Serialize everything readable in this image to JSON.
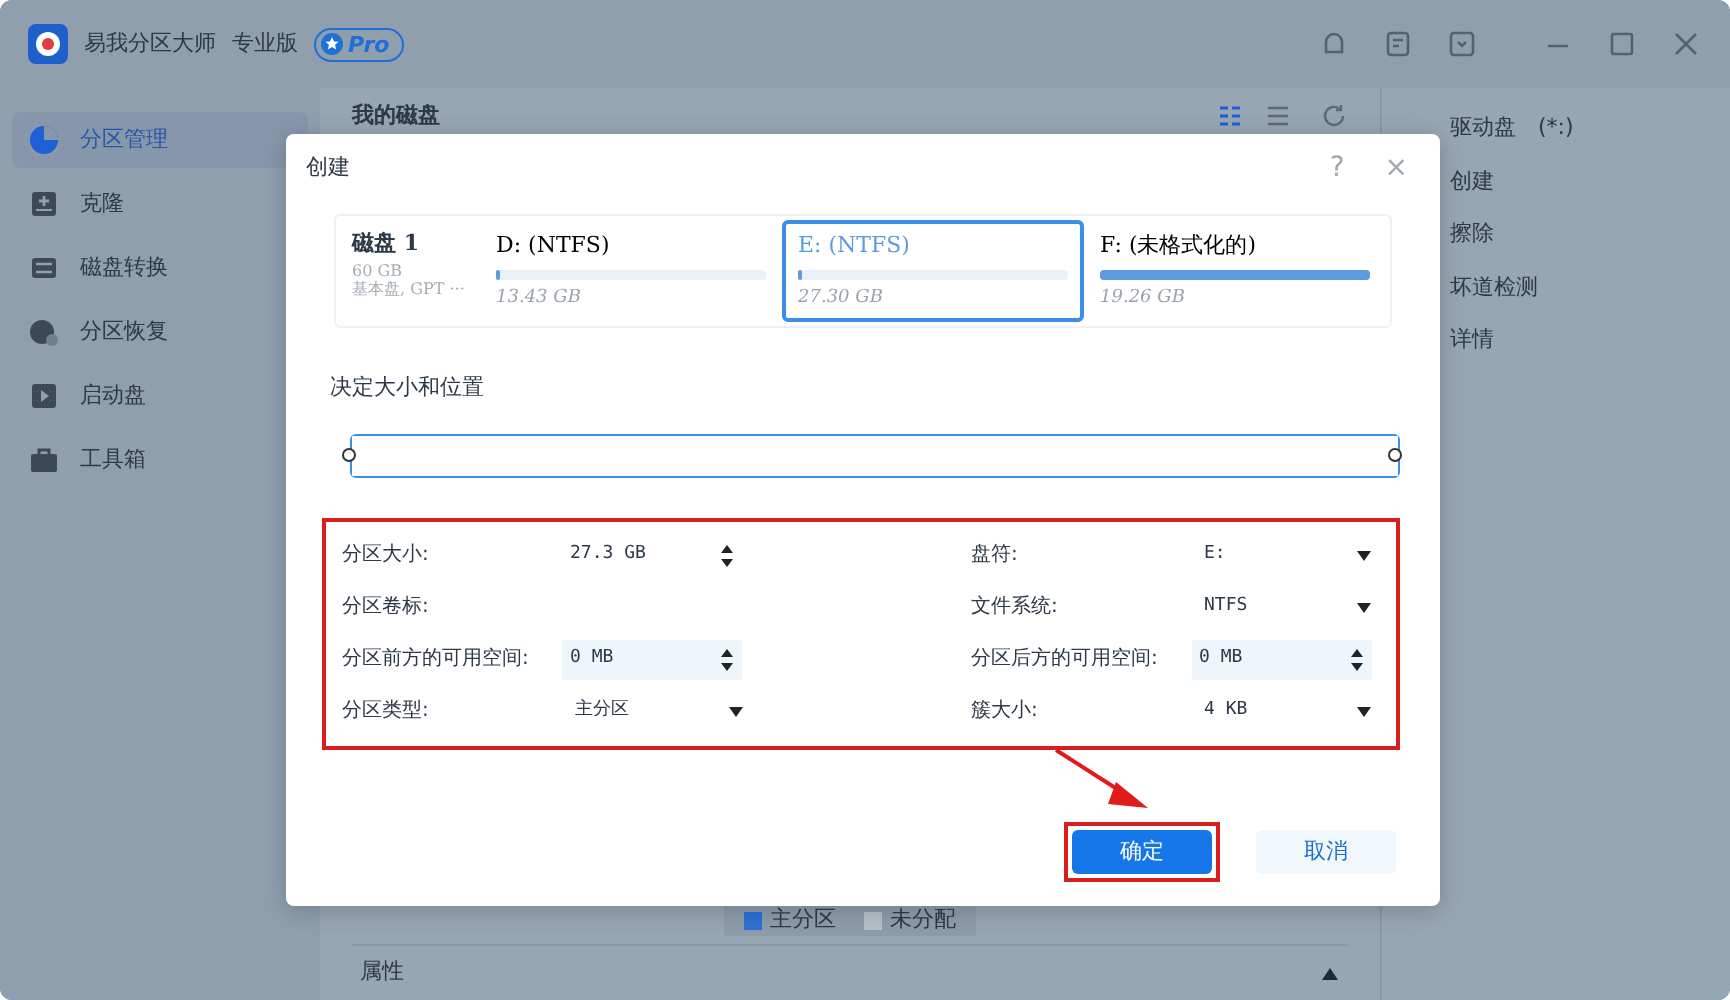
{
  "app": {
    "title": "易我分区大师",
    "edition": "专业版",
    "badge": "Pro"
  },
  "sidebar": {
    "items": [
      {
        "label": "分区管理",
        "selected": true
      },
      {
        "label": "克隆",
        "selected": false
      },
      {
        "label": "磁盘转换",
        "selected": false
      },
      {
        "label": "分区恢复",
        "selected": false
      },
      {
        "label": "启动盘",
        "selected": false
      },
      {
        "label": "工具箱",
        "selected": false
      }
    ]
  },
  "main": {
    "title": "我的磁盘",
    "legend": [
      {
        "label": "主分区",
        "color": "#2f6fd6"
      },
      {
        "label": "未分配",
        "color": "#b5c0ca"
      }
    ],
    "properties": {
      "label": "属性",
      "expanded": true
    }
  },
  "right_panel": {
    "title": "驱动盘　(*:)",
    "actions": [
      "创建",
      "擦除",
      "坏道检测",
      "详情"
    ]
  },
  "dialog": {
    "title": "创建",
    "help": "?",
    "close": "×",
    "disk": {
      "name": "磁盘 1",
      "size": "60 GB",
      "info": "基本盘, GPT ···"
    },
    "partitions": [
      {
        "label": "D: (NTFS)",
        "size": "13.43 GB",
        "level": 0.01,
        "selected": false
      },
      {
        "label": "E: (NTFS)",
        "size": "27.30 GB",
        "level": 0.01,
        "selected": true
      },
      {
        "label": "F: (未格式化的)",
        "size": "19.26 GB",
        "level": 1,
        "selected": false
      }
    ],
    "section": "决定大小和位置",
    "slider": {
      "level": 1
    },
    "fields": [
      {
        "label": "分区大小:",
        "kind": "spinner",
        "value": "27.3 GB",
        "shaded": false
      },
      {
        "label": "盘符:",
        "kind": "dropdown",
        "value": "E:"
      },
      {
        "label": "分区卷标:",
        "kind": "text"
      },
      {
        "label": "文件系统:",
        "kind": "dropdown",
        "value": "NTFS"
      },
      {
        "label": "分区前方的可用空间:",
        "kind": "spinner",
        "value": "0 MB",
        "shaded": true
      },
      {
        "label": "分区后方的可用空间:",
        "kind": "spinner",
        "value": "0 MB",
        "shaded": true
      },
      {
        "label": "分区类型:",
        "kind": "dropdown",
        "value": "主分区"
      },
      {
        "label": "簇大小:",
        "kind": "dropdown",
        "value": "4 KB"
      }
    ],
    "buttons": [
      {
        "label": "确定",
        "kind": "primary"
      },
      {
        "label": "取消",
        "kind": "secondary"
      }
    ],
    "annotations": {
      "outline_fields": true,
      "outline_confirm": true,
      "arrow": true
    }
  }
}
